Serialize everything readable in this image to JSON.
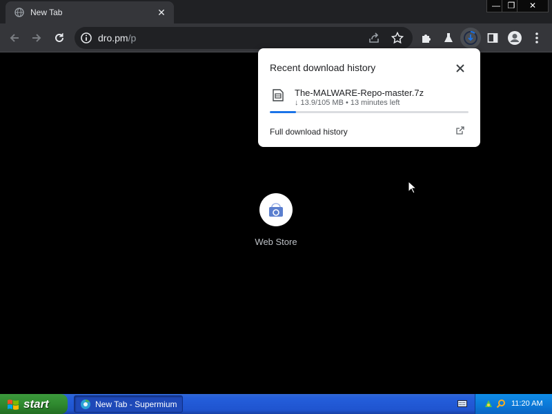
{
  "browser": {
    "tab": {
      "title": "New Tab",
      "favicon": "globe-icon",
      "close": "✕"
    },
    "window_controls": {
      "minimize": "—",
      "maximize": "❐",
      "close": "✕"
    },
    "address": {
      "host": "dro.pm",
      "path": "/p"
    }
  },
  "download_bubble": {
    "title": "Recent download history",
    "item": {
      "filename": "The-MALWARE-Repo-master.7z",
      "status": "↓  13.9/105 MB • 13 minutes left",
      "progress": 0.132
    },
    "footer_link": "Full download history"
  },
  "shortcut": {
    "label": "Web Store",
    "icon": "web-store-icon"
  },
  "taskbar": {
    "start_label": "start",
    "task_label": "New Tab - Supermium",
    "clock": "11:20 AM"
  },
  "colors": {
    "accent": "#1a73e8",
    "toolbar": "#35363a",
    "tabstrip": "#202124",
    "taskbar": "#245edb",
    "start_button": "#2f8a2f"
  }
}
